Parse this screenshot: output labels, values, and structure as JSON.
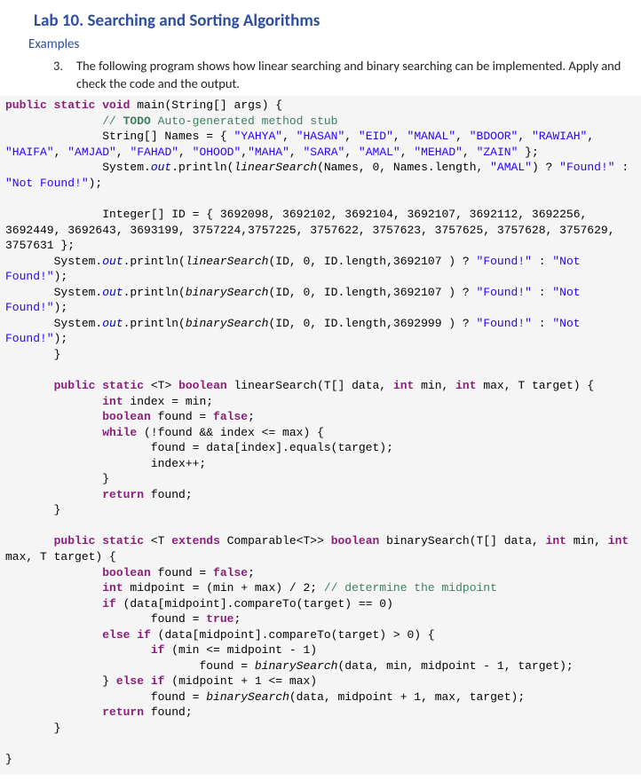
{
  "title": "Lab 10. Searching and Sorting Algorithms",
  "subtitle": "Examples",
  "instruction": {
    "number": "3.",
    "text": "The following program shows how linear searching and binary searching can be implemented. Apply and check the code and the output."
  },
  "code": {
    "kw_public": "public",
    "kw_static": "static",
    "kw_void": "void",
    "kw_boolean": "boolean",
    "kw_int": "int",
    "kw_false": "false",
    "kw_true": "true",
    "kw_while": "while",
    "kw_return": "return",
    "kw_if": "if",
    "kw_else": "else",
    "kw_extends": "extends",
    "main_sig_a": " main(String[] args) {",
    "todo_comment_pre": "// ",
    "todo_comment_a": "TODO",
    "todo_comment_b": " Auto-generated method stub",
    "names_decl_a": "String[] Names = { ",
    "s_yahya": "\"YAHYA\"",
    "s_hasan": "\"HASAN\"",
    "s_eid": "\"EID\"",
    "s_manal": "\"MANAL\"",
    "s_bdoor": "\"BDOOR\"",
    "s_rawiah": "\"RAWIAH\"",
    "s_haifa": "\"HAIFA\"",
    "s_amjad": "\"AMJAD\"",
    "s_fahad": "\"FAHAD\"",
    "s_ohood": "\"OHOOD\"",
    "s_maha": "\"MAHA\"",
    "s_sara": "\"SARA\"",
    "s_amal": "\"AMAL\"",
    "s_mehad": "\"MEHAD\"",
    "s_zain": "\"ZAIN\"",
    "names_end": " };",
    "sysout_pre": "System.",
    "field_out": "out",
    "println_open": ".println(",
    "linearSearch": "linearSearch",
    "binarySearch": "binarySearch",
    "ls_args_a": "(Names, 0, Names.length, ",
    "s_amal2": "\"AMAL\"",
    "ternary_a": ") ? ",
    "s_found": "\"Found!\"",
    "colon": " : ",
    "s_notfound": "\"Not Found!\"",
    "close_paren_semi": ");",
    "id_decl_a": "Integer[] ID = { 3692098, 3692102, 3692104, 3692107, 3692112, 3692256, 3692449, 3692643, 3693199, 3757224,3757225, 3757622, 3757623, 3757625, 3757628, 3757629, 3757631 };",
    "ls_id_args": "(ID, 0, ID.length,3692107 ) ? ",
    "bs_id_args1": "(ID, 0, ID.length,3692107 ) ? ",
    "bs_id_args2": "(ID, 0, ID.length,3692999 ) ? ",
    "close_brace": "}",
    "ls_sig_a": " <T> ",
    "ls_sig_b": " linearSearch(T[] data, ",
    "ls_sig_c": " min, ",
    "ls_sig_d": " max, T target) {",
    "ls_l1_b": " index = min;",
    "ls_l2_b": " found = ",
    "semi": ";",
    "ls_l3_b": " (!found && index <= max) {",
    "ls_l4": "found = data[index].equals(target);",
    "ls_l5": "index++;",
    "ls_l7_b": " found;",
    "bs_sig_a": " <T ",
    "bs_sig_b": " Comparable<T>> ",
    "bs_sig_c": " binarySearch(T[] data, ",
    "bs_sig_d": " min, ",
    "bs_sig_e": " max, T target) {",
    "bs_l1_b": " found = ",
    "bs_l2_b": " midpoint = (min + max) / 2; ",
    "bs_l2_comment": "// determine the midpoint",
    "bs_l3_b": " (data[midpoint].compareTo(target) == 0)",
    "bs_l4": "found = ",
    "bs_l5_b": " (data[midpoint].compareTo(target) > 0) {",
    "bs_l6_b": " (min <= midpoint - 1)",
    "bs_l7": "found = ",
    "bs_l7_args": "(data, min, midpoint - 1, target);",
    "bs_l8": "} ",
    "bs_l8_b": " (midpoint + 1 <= max)",
    "bs_l9": "found = ",
    "bs_l9_args": "(data, midpoint + 1, max, target);",
    "bs_l10_b": " found;"
  }
}
